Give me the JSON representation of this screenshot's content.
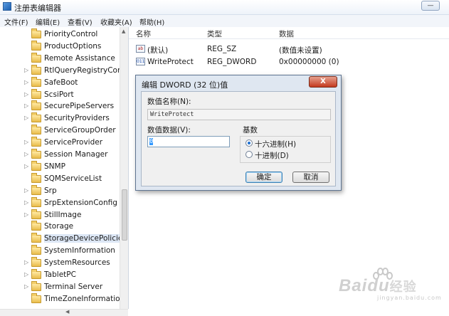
{
  "window": {
    "title": "注册表编辑器",
    "min_button": "—"
  },
  "menubar": {
    "items": [
      {
        "label": "文件(F)"
      },
      {
        "label": "编辑(E)"
      },
      {
        "label": "查看(V)"
      },
      {
        "label": "收藏夹(A)"
      },
      {
        "label": "帮助(H)"
      }
    ]
  },
  "tree": {
    "items": [
      {
        "label": "PriorityControl",
        "expandable": false
      },
      {
        "label": "ProductOptions",
        "expandable": false
      },
      {
        "label": "Remote Assistance",
        "expandable": false
      },
      {
        "label": "RtlQueryRegistryConf",
        "expandable": true
      },
      {
        "label": "SafeBoot",
        "expandable": true
      },
      {
        "label": "ScsiPort",
        "expandable": true
      },
      {
        "label": "SecurePipeServers",
        "expandable": true
      },
      {
        "label": "SecurityProviders",
        "expandable": true
      },
      {
        "label": "ServiceGroupOrder",
        "expandable": false
      },
      {
        "label": "ServiceProvider",
        "expandable": true
      },
      {
        "label": "Session Manager",
        "expandable": true
      },
      {
        "label": "SNMP",
        "expandable": true
      },
      {
        "label": "SQMServiceList",
        "expandable": false
      },
      {
        "label": "Srp",
        "expandable": true
      },
      {
        "label": "SrpExtensionConfig",
        "expandable": true
      },
      {
        "label": "StillImage",
        "expandable": true
      },
      {
        "label": "Storage",
        "expandable": false
      },
      {
        "label": "StorageDevicePolicies",
        "expandable": false,
        "selected": true
      },
      {
        "label": "SystemInformation",
        "expandable": false
      },
      {
        "label": "SystemResources",
        "expandable": true
      },
      {
        "label": "TabletPC",
        "expandable": true
      },
      {
        "label": "Terminal Server",
        "expandable": true
      },
      {
        "label": "TimeZoneInformation",
        "expandable": false
      }
    ]
  },
  "list": {
    "columns": [
      "名称",
      "类型",
      "数据"
    ],
    "rows": [
      {
        "icon": "string-value-icon",
        "icon_text": "ab",
        "name": "(默认)",
        "type": "REG_SZ",
        "data": "(数值未设置)"
      },
      {
        "icon": "binary-value-icon",
        "icon_text": "011",
        "name": "WriteProtect",
        "type": "REG_DWORD",
        "data": "0x00000000 (0)"
      }
    ]
  },
  "dialog": {
    "title": "编辑 DWORD (32 位)值",
    "close_label": "X",
    "value_name_label": "数值名称(N):",
    "value_name": "WriteProtect",
    "value_data_label": "数值数据(V):",
    "value_data": "0",
    "base_label": "基数",
    "base_options": [
      {
        "label": "十六进制(H)",
        "checked": true
      },
      {
        "label": "十进制(D)",
        "checked": false
      }
    ],
    "ok_label": "确定",
    "cancel_label": "取消"
  },
  "watermark": {
    "brand": "Baidu",
    "brand_suffix": "经验",
    "sub": "jingyan.baidu.com"
  },
  "colors": {
    "dialog_frame": "#dfe7f1",
    "close_button": "#c4391e",
    "selection": "#3399ff"
  }
}
